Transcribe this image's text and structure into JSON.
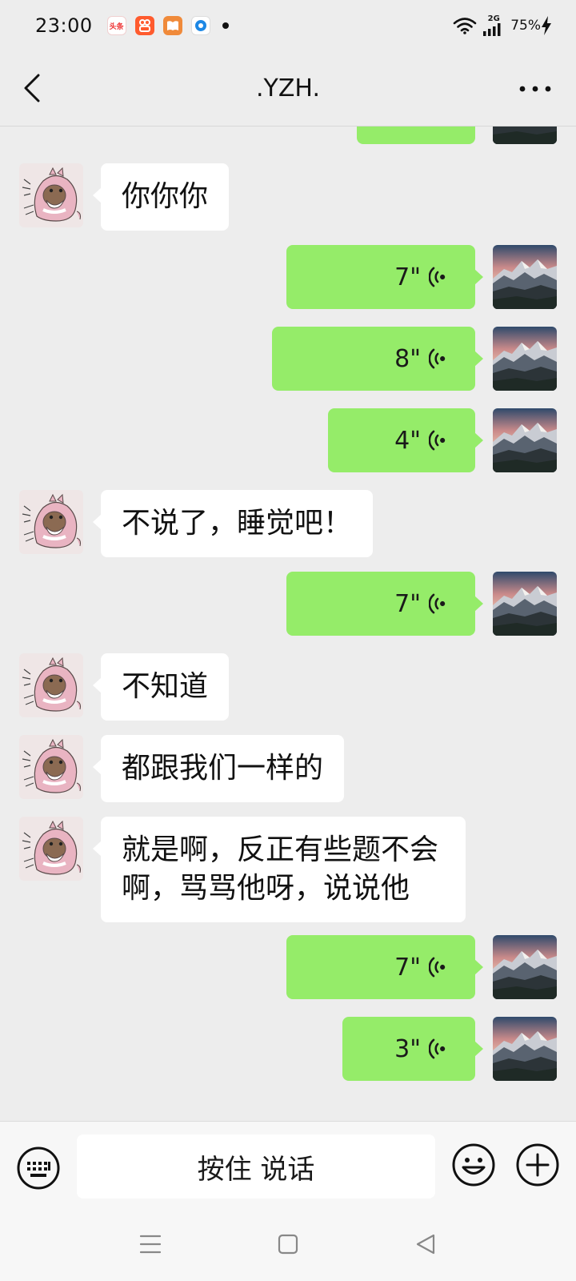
{
  "status_bar": {
    "time": "23:00",
    "toutiao_label": "头条",
    "network": "2G",
    "battery": "75%",
    "icons": [
      "toutiao-app-icon",
      "kuaishou-app-icon",
      "reader-app-icon",
      "browser-app-icon",
      "wifi-icon",
      "signal-icon",
      "charging-icon"
    ]
  },
  "header": {
    "title": ".YZH.",
    "back_icon": "chevron-left-icon",
    "more_icon": "more-dots-icon"
  },
  "messages": [
    {
      "side": "right",
      "type": "voice",
      "duration": ""
    },
    {
      "side": "left",
      "type": "text",
      "text": "你你你"
    },
    {
      "side": "right",
      "type": "voice",
      "duration": "7\""
    },
    {
      "side": "right",
      "type": "voice",
      "duration": "8\""
    },
    {
      "side": "right",
      "type": "voice",
      "duration": "4\""
    },
    {
      "side": "left",
      "type": "text",
      "text": "不说了，睡觉吧！"
    },
    {
      "side": "right",
      "type": "voice",
      "duration": "7\""
    },
    {
      "side": "left",
      "type": "text",
      "text": "不知道"
    },
    {
      "side": "left",
      "type": "text",
      "text": "都跟我们一样的"
    },
    {
      "side": "left",
      "type": "text",
      "text": "就是啊，反正有些题不会啊，骂骂他呀，说说他"
    },
    {
      "side": "right",
      "type": "voice",
      "duration": "7\""
    },
    {
      "side": "right",
      "type": "voice",
      "duration": "3\""
    }
  ],
  "input_bar": {
    "hold_to_talk_label": "按住 说话",
    "keyboard_icon": "keyboard-icon",
    "emoji_icon": "emoji-icon",
    "plus_icon": "plus-icon"
  },
  "nav_bar": {
    "icons": [
      "menu-icon",
      "home-icon",
      "back-icon"
    ]
  },
  "colors": {
    "background": "#EDEDED",
    "outgoing_bubble": "#95EC69",
    "incoming_bubble": "#FFFFFF"
  }
}
